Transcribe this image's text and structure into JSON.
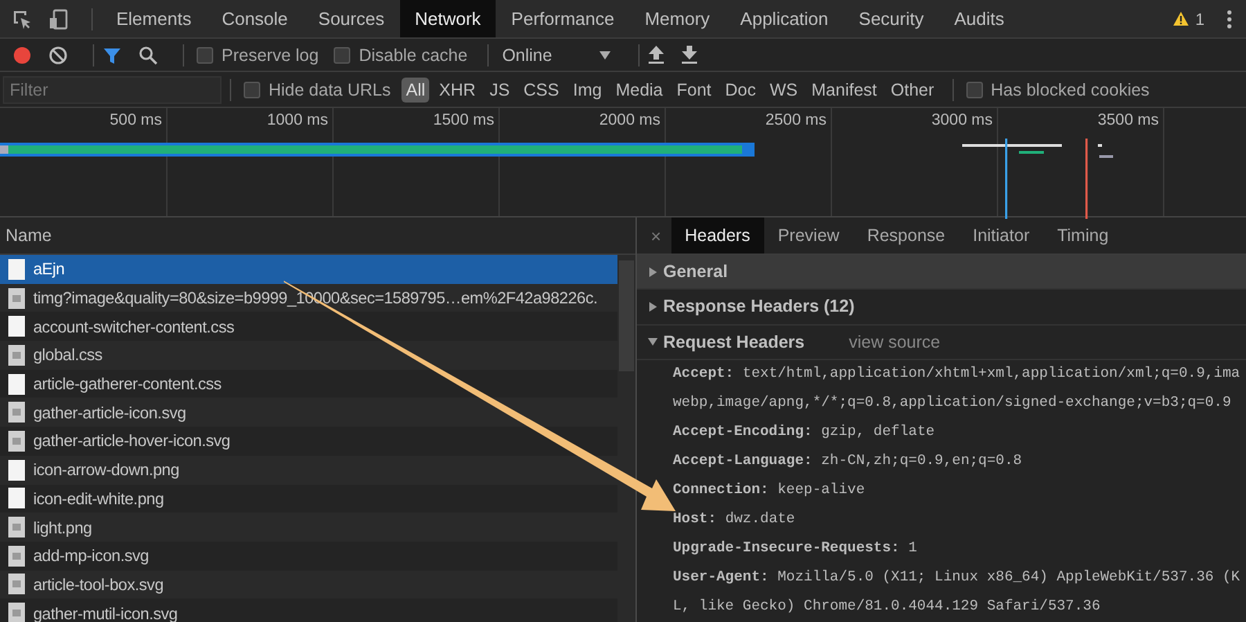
{
  "main_tabs": [
    {
      "label": "Elements",
      "selected": false
    },
    {
      "label": "Console",
      "selected": false
    },
    {
      "label": "Sources",
      "selected": false
    },
    {
      "label": "Network",
      "selected": true
    },
    {
      "label": "Performance",
      "selected": false
    },
    {
      "label": "Memory",
      "selected": false
    },
    {
      "label": "Application",
      "selected": false
    },
    {
      "label": "Security",
      "selected": false
    },
    {
      "label": "Audits",
      "selected": false
    }
  ],
  "warnings": {
    "count": "1"
  },
  "toolbar": {
    "preserve_log": {
      "label": "Preserve log",
      "checked": false
    },
    "disable_cache": {
      "label": "Disable cache",
      "checked": false
    },
    "throttling": {
      "value": "Online"
    }
  },
  "filter_bar": {
    "placeholder": "Filter",
    "hide_data_urls": {
      "label": "Hide data URLs",
      "checked": false
    },
    "types": [
      {
        "label": "All",
        "selected": true
      },
      {
        "label": "XHR",
        "selected": false
      },
      {
        "label": "JS",
        "selected": false
      },
      {
        "label": "CSS",
        "selected": false
      },
      {
        "label": "Img",
        "selected": false
      },
      {
        "label": "Media",
        "selected": false
      },
      {
        "label": "Font",
        "selected": false
      },
      {
        "label": "Doc",
        "selected": false
      },
      {
        "label": "WS",
        "selected": false
      },
      {
        "label": "Manifest",
        "selected": false
      },
      {
        "label": "Other",
        "selected": false
      }
    ],
    "has_blocked_cookies": {
      "label": "Has blocked cookies",
      "checked": false
    }
  },
  "overview": {
    "ticks": [
      "500 ms",
      "1000 ms",
      "1500 ms",
      "2000 ms",
      "2500 ms",
      "3000 ms",
      "3500 ms"
    ]
  },
  "requests": {
    "column": "Name",
    "rows": [
      {
        "name": "aEjn",
        "kind": "document",
        "selected": true
      },
      {
        "name": "timg?image&quality=80&size=b9999_10000&sec=1589795…em%2F42a98226c.",
        "kind": "image",
        "selected": false
      },
      {
        "name": "account-switcher-content.css",
        "kind": "document",
        "selected": false
      },
      {
        "name": "global.css",
        "kind": "image",
        "selected": false
      },
      {
        "name": "article-gatherer-content.css",
        "kind": "document",
        "selected": false
      },
      {
        "name": "gather-article-icon.svg",
        "kind": "image",
        "selected": false
      },
      {
        "name": "gather-article-hover-icon.svg",
        "kind": "image",
        "selected": false
      },
      {
        "name": "icon-arrow-down.png",
        "kind": "document",
        "selected": false
      },
      {
        "name": "icon-edit-white.png",
        "kind": "document",
        "selected": false
      },
      {
        "name": "light.png",
        "kind": "image",
        "selected": false
      },
      {
        "name": "add-mp-icon.svg",
        "kind": "image",
        "selected": false
      },
      {
        "name": "article-tool-box.svg",
        "kind": "image",
        "selected": false
      },
      {
        "name": "gather-mutil-icon.svg",
        "kind": "image",
        "selected": false
      }
    ]
  },
  "details": {
    "close": "×",
    "tabs": [
      {
        "label": "Headers",
        "selected": true
      },
      {
        "label": "Preview",
        "selected": false
      },
      {
        "label": "Response",
        "selected": false
      },
      {
        "label": "Initiator",
        "selected": false
      },
      {
        "label": "Timing",
        "selected": false
      }
    ],
    "sections": [
      {
        "title": "General",
        "expanded": false
      },
      {
        "title": "Response Headers (12)",
        "expanded": false
      },
      {
        "title": "Request Headers",
        "expanded": true,
        "link": "view source",
        "headers": [
          {
            "text": "**Accept:** text/html,application/xhtml+xml,application/xml;q=0.9,ima",
            "continuation": "webp,image/apng,*/*;q=0.8,application/signed-exchange;v=b3;q=0.9"
          },
          {
            "text": "**Accept-Encoding:** gzip, deflate"
          },
          {
            "text": "**Accept-Language:** zh-CN,zh;q=0.9,en;q=0.8"
          },
          {
            "text": "**Connection:** keep-alive"
          },
          {
            "text": "**Host:** dwz.date"
          },
          {
            "text": "**Upgrade-Insecure-Requests:** 1"
          },
          {
            "text": "**User-Agent:** Mozilla/5.0 (X11; Linux x86_64) AppleWebKit/537.36 (K",
            "continuation": "L, like Gecko) Chrome/81.0.4044.129 Safari/537.36"
          }
        ]
      }
    ]
  }
}
